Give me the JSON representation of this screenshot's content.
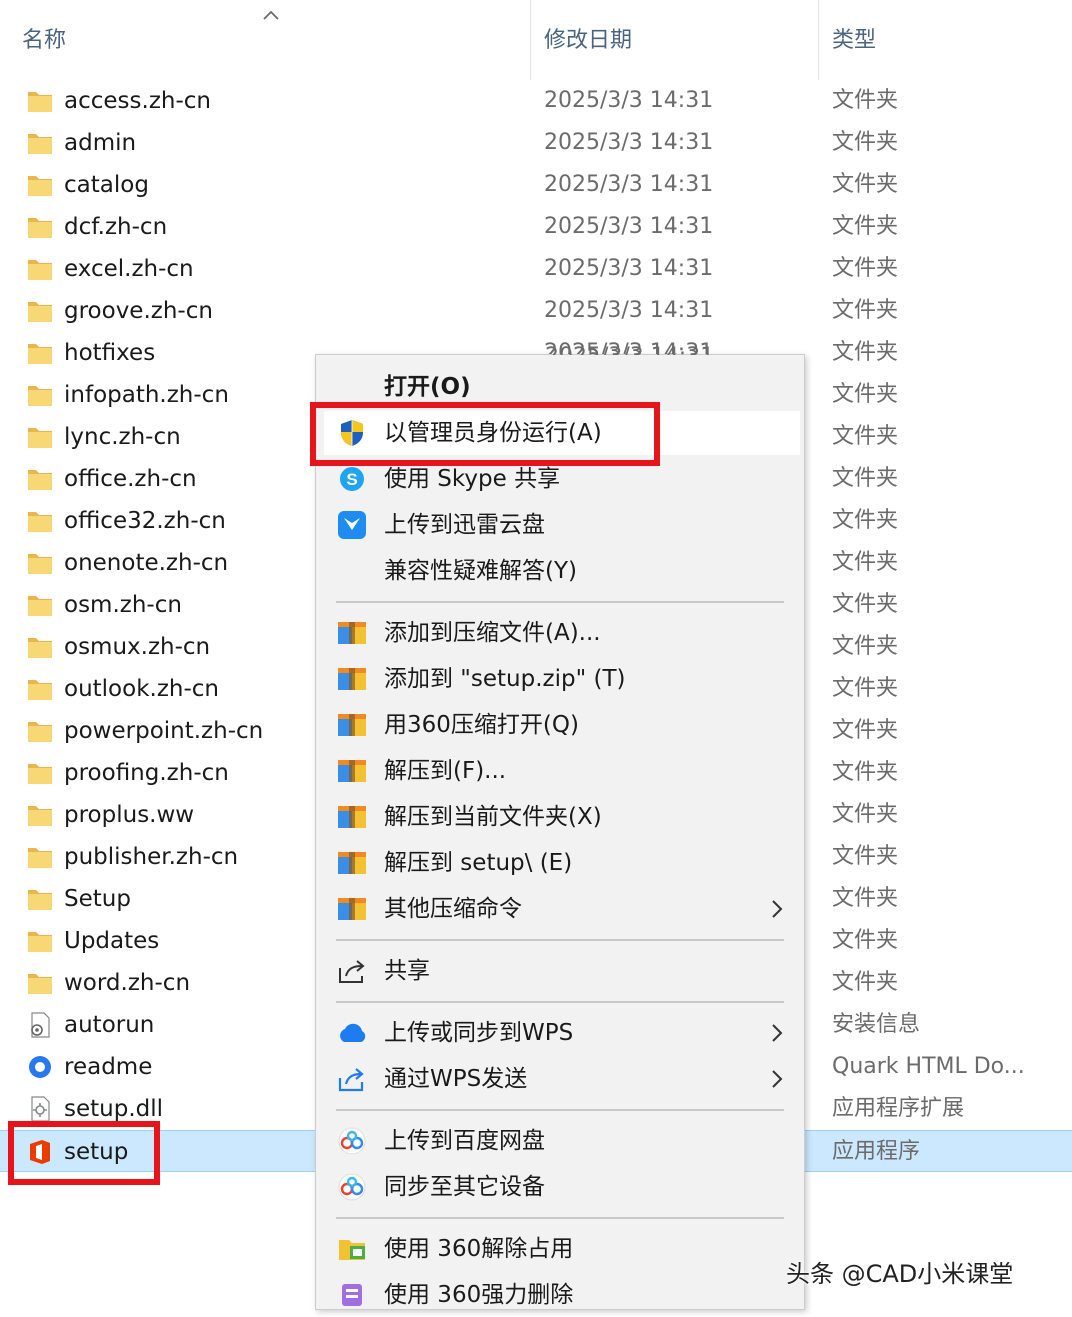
{
  "header": {
    "name": "名称",
    "date": "修改日期",
    "type": "类型"
  },
  "files": [
    {
      "name": "access.zh-cn",
      "date": "2025/3/3 14:31",
      "type": "文件夹",
      "icon": "folder"
    },
    {
      "name": "admin",
      "date": "2025/3/3 14:31",
      "type": "文件夹",
      "icon": "folder"
    },
    {
      "name": "catalog",
      "date": "2025/3/3 14:31",
      "type": "文件夹",
      "icon": "folder"
    },
    {
      "name": "dcf.zh-cn",
      "date": "2025/3/3 14:31",
      "type": "文件夹",
      "icon": "folder"
    },
    {
      "name": "excel.zh-cn",
      "date": "2025/3/3 14:31",
      "type": "文件夹",
      "icon": "folder"
    },
    {
      "name": "groove.zh-cn",
      "date": "2025/3/3 14:31",
      "type": "文件夹",
      "icon": "folder"
    },
    {
      "name": "hotfixes",
      "date": "2025/3/3 14:31",
      "type": "文件夹",
      "icon": "folder"
    },
    {
      "name": "infopath.zh-cn",
      "date": "",
      "type": "文件夹",
      "icon": "folder"
    },
    {
      "name": "lync.zh-cn",
      "date": "",
      "type": "文件夹",
      "icon": "folder"
    },
    {
      "name": "office.zh-cn",
      "date": "",
      "type": "文件夹",
      "icon": "folder"
    },
    {
      "name": "office32.zh-cn",
      "date": "",
      "type": "文件夹",
      "icon": "folder"
    },
    {
      "name": "onenote.zh-cn",
      "date": "",
      "type": "文件夹",
      "icon": "folder"
    },
    {
      "name": "osm.zh-cn",
      "date": "",
      "type": "文件夹",
      "icon": "folder"
    },
    {
      "name": "osmux.zh-cn",
      "date": "",
      "type": "文件夹",
      "icon": "folder"
    },
    {
      "name": "outlook.zh-cn",
      "date": "",
      "type": "文件夹",
      "icon": "folder"
    },
    {
      "name": "powerpoint.zh-cn",
      "date": "",
      "type": "文件夹",
      "icon": "folder"
    },
    {
      "name": "proofing.zh-cn",
      "date": "",
      "type": "文件夹",
      "icon": "folder"
    },
    {
      "name": "proplus.ww",
      "date": "",
      "type": "文件夹",
      "icon": "folder"
    },
    {
      "name": "publisher.zh-cn",
      "date": "",
      "type": "文件夹",
      "icon": "folder"
    },
    {
      "name": "Setup",
      "date": "",
      "type": "文件夹",
      "icon": "folder"
    },
    {
      "name": "Updates",
      "date": "",
      "type": "文件夹",
      "icon": "folder"
    },
    {
      "name": "word.zh-cn",
      "date": "",
      "type": "文件夹",
      "icon": "folder"
    },
    {
      "name": "autorun",
      "date": "",
      "type": "安装信息",
      "icon": "setup-info"
    },
    {
      "name": "readme",
      "date": "",
      "type": "Quark HTML Do...",
      "icon": "quark"
    },
    {
      "name": "setup.dll",
      "date": "",
      "type": "应用程序扩展",
      "icon": "dll"
    },
    {
      "name": "setup",
      "date": "",
      "type": "应用程序",
      "icon": "office",
      "selected": true
    }
  ],
  "menu": [
    {
      "label": "打开(O)",
      "icon": "none",
      "bold": true
    },
    {
      "label": "以管理员身份运行(A)",
      "icon": "shield",
      "hover": true
    },
    {
      "label": "使用 Skype 共享",
      "icon": "skype"
    },
    {
      "label": "上传到迅雷云盘",
      "icon": "xunlei"
    },
    {
      "label": "兼容性疑难解答(Y)",
      "icon": "none"
    },
    {
      "sep": true
    },
    {
      "label": "添加到压缩文件(A)...",
      "icon": "archive"
    },
    {
      "label": "添加到 \"setup.zip\" (T)",
      "icon": "archive"
    },
    {
      "label": "用360压缩打开(Q)",
      "icon": "archive"
    },
    {
      "label": "解压到(F)...",
      "icon": "archive"
    },
    {
      "label": "解压到当前文件夹(X)",
      "icon": "archive"
    },
    {
      "label": "解压到 setup\\ (E)",
      "icon": "archive"
    },
    {
      "label": "其他压缩命令",
      "icon": "archive",
      "submenu": true
    },
    {
      "sep": true
    },
    {
      "label": "共享",
      "icon": "share"
    },
    {
      "sep": true
    },
    {
      "label": "上传或同步到WPS",
      "icon": "wps-cloud",
      "submenu": true
    },
    {
      "label": "通过WPS发送",
      "icon": "wps-send",
      "submenu": true
    },
    {
      "sep": true
    },
    {
      "label": "上传到百度网盘",
      "icon": "baidu"
    },
    {
      "label": "同步至其它设备",
      "icon": "baidu"
    },
    {
      "sep": true
    },
    {
      "label": "使用 360解除占用",
      "icon": "unlock-360"
    },
    {
      "label": "使用 360强力删除",
      "icon": "delete-360"
    }
  ],
  "partial_date_text": "2025/3/3 14:31",
  "watermark": "头条 @CAD小米课堂",
  "colors": {
    "selection": "#cce8ff",
    "highlight_red": "#e8141c",
    "menu_bg": "#f2f2f2",
    "folder": "#f8d775"
  }
}
